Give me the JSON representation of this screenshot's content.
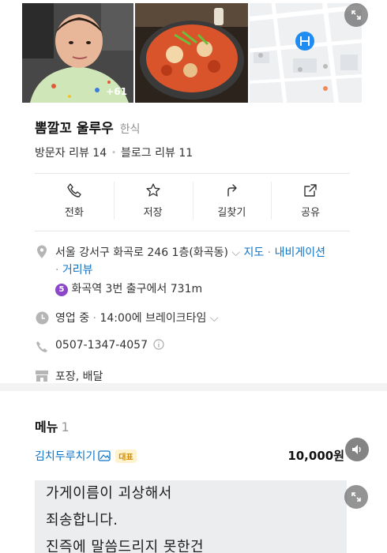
{
  "photos": {
    "count_badge": "+61"
  },
  "place": {
    "name": "뽐깔꼬 울루우",
    "category": "한식",
    "visitor_reviews": "방문자 리뷰 14",
    "blog_reviews": "블로그 리뷰 11"
  },
  "actions": {
    "call": "전화",
    "save": "저장",
    "directions": "길찾기",
    "share": "공유"
  },
  "address": {
    "text": "서울 강서구 화곡로 246 1층(화곡동)",
    "map_link": "지도",
    "navigation_link": "내비게이션",
    "street_view_link": "거리뷰",
    "subway_line": "5",
    "subway_text": "화곡역 3번 출구에서 731m"
  },
  "hours": {
    "status": "영업 중",
    "detail": "14:00에 브레이크타임"
  },
  "phone": {
    "number": "0507-1347-4057"
  },
  "services": {
    "text": "포장, 배달"
  },
  "menu": {
    "title": "메뉴",
    "count": "1",
    "item_name": "김치두루치기",
    "rep_badge": "대표",
    "item_price": "10,000원"
  },
  "caption": {
    "line1": "가게이름이 괴상해서",
    "line2": "죄송합니다.",
    "line3": "진즉에 말씀드리지 못한건"
  },
  "colors": {
    "link_blue": "#0f74c7",
    "subway_purple": "#8b46c9",
    "badge_yellow": "#d28b00"
  }
}
